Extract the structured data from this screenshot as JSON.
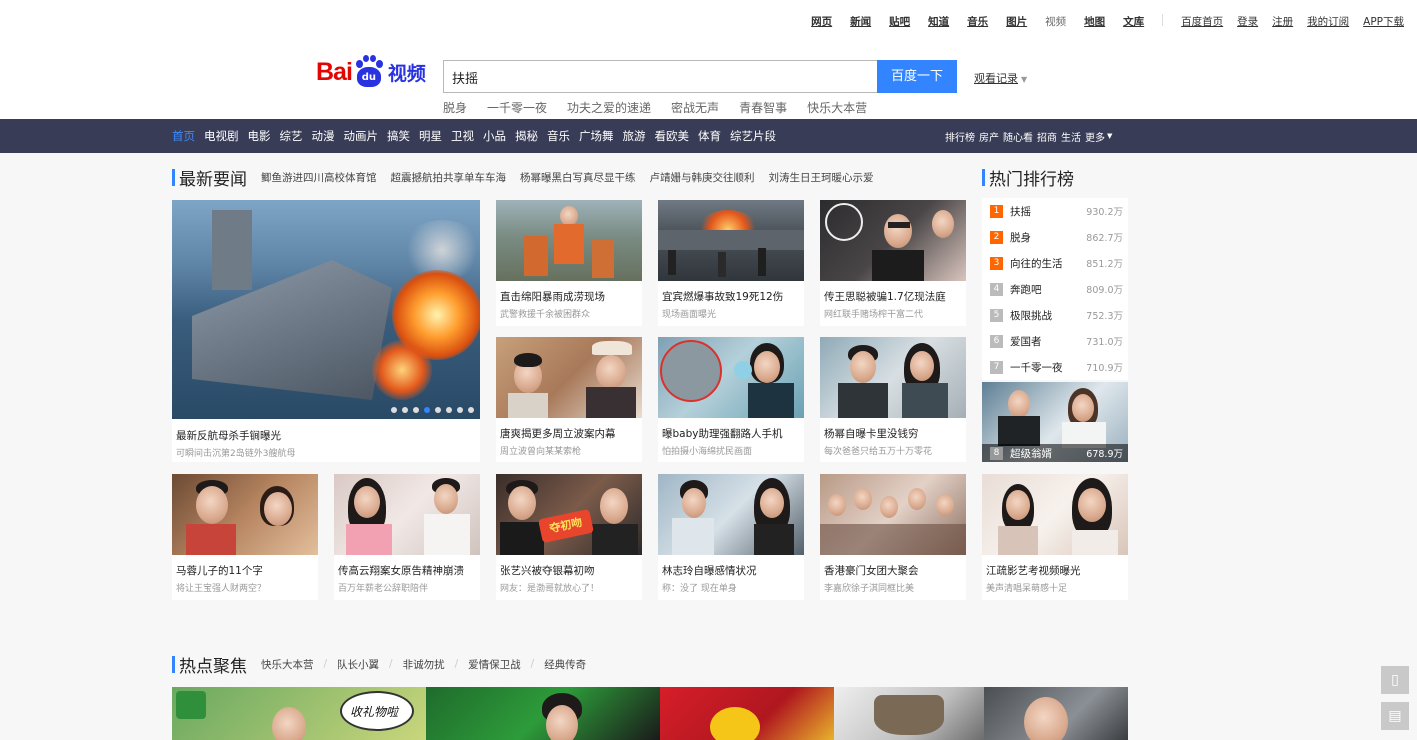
{
  "toplinks": {
    "products": [
      "网页",
      "新闻",
      "贴吧",
      "知道",
      "音乐",
      "图片",
      "视频",
      "地图",
      "文库"
    ],
    "user": [
      "百度首页",
      "登录",
      "注册",
      "我的订阅",
      "APP下载"
    ]
  },
  "logo": {
    "bai": "Bai",
    "du": "du",
    "video": "视频"
  },
  "search": {
    "value": "扶摇",
    "button": "百度一下",
    "history": "观看记录"
  },
  "hotwords": [
    "脱身",
    "一千零一夜",
    "功夫之爱的速递",
    "密战无声",
    "青春智事",
    "快乐大本营"
  ],
  "nav": {
    "left": [
      "首页",
      "电视剧",
      "电影",
      "综艺",
      "动漫",
      "动画片",
      "搞笑",
      "明星",
      "卫视",
      "小品",
      "揭秘",
      "音乐",
      "广场舞",
      "旅游",
      "看欧美",
      "体育",
      "综艺片段"
    ],
    "right": [
      "排行榜",
      "房产",
      "随心看",
      "招商",
      "生活",
      "更多"
    ]
  },
  "news": {
    "title": "最新要闻",
    "subs": [
      "鲫鱼游进四川高校体育馆",
      "超震撼航拍共享单车车海",
      "杨幂曝黑白写真尽显干练",
      "卢靖姗与韩庚交往顺利",
      "刘涛生日王珂暖心示爱"
    ],
    "hero": {
      "title": "最新反航母杀手锏曝光",
      "desc": "可瞬间击沉第2岛链外3艘航母"
    },
    "cards": [
      {
        "title": "直击绵阳暴雨成涝现场",
        "desc": "武警救援千余被困群众"
      },
      {
        "title": "宜宾燃爆事故致19死12伤",
        "desc": "现场画面曝光"
      },
      {
        "title": "传王思聪被骗1.7亿现法庭",
        "desc": "网红联手赌场榨干富二代"
      },
      {
        "title": "唐爽揭更多周立波案内幕",
        "desc": "周立波曾向某某索枪"
      },
      {
        "title": "曝baby助理强翻路人手机",
        "desc": "怕拍摄小海绵扰民画面"
      },
      {
        "title": "杨幂自曝卡里没钱穷",
        "desc": "每次爸爸只给五万十万零花"
      },
      {
        "title": "马蓉儿子的11个字",
        "desc": "将让王宝强人财两空？"
      },
      {
        "title": "传高云翔案女原告精神崩溃",
        "desc": "百万年薪老公辞职陪伴"
      },
      {
        "title": "张艺兴被夺银幕初吻",
        "desc": "网友：是渤哥就放心了！"
      },
      {
        "title": "林志玲自曝感情状况",
        "desc": "称：没了 现在单身"
      },
      {
        "title": "香港豪门女团大聚会",
        "desc": "李嘉欣徐子淇同框比美"
      },
      {
        "title": "江疏影艺考视频曝光",
        "desc": "美声清唱呆萌感十足"
      }
    ],
    "stamp": "夺初吻"
  },
  "ranking": {
    "title": "热门排行榜",
    "items": [
      {
        "n": "1",
        "name": "扶摇",
        "count": "930.2万"
      },
      {
        "n": "2",
        "name": "脱身",
        "count": "862.7万"
      },
      {
        "n": "3",
        "name": "向往的生活",
        "count": "851.2万"
      },
      {
        "n": "4",
        "name": "奔跑吧",
        "count": "809.0万"
      },
      {
        "n": "5",
        "name": "极限挑战",
        "count": "752.3万"
      },
      {
        "n": "6",
        "name": "爱国者",
        "count": "731.0万"
      },
      {
        "n": "7",
        "name": "一千零一夜",
        "count": "710.9万"
      }
    ],
    "featured": {
      "n": "8",
      "name": "超级翁婿",
      "count": "678.9万"
    }
  },
  "focus": {
    "title": "热点聚焦",
    "tabs": [
      "快乐大本营",
      "队长小翼",
      "非诚勿扰",
      "爱情保卫战",
      "经典传奇"
    ],
    "bubble": "收礼物啦"
  },
  "colors": {
    "accent": "#3385ff",
    "nav_bg": "#383c56",
    "hot": "#ff6600",
    "brand_red": "#e10601",
    "brand_blue": "#2932e1"
  }
}
